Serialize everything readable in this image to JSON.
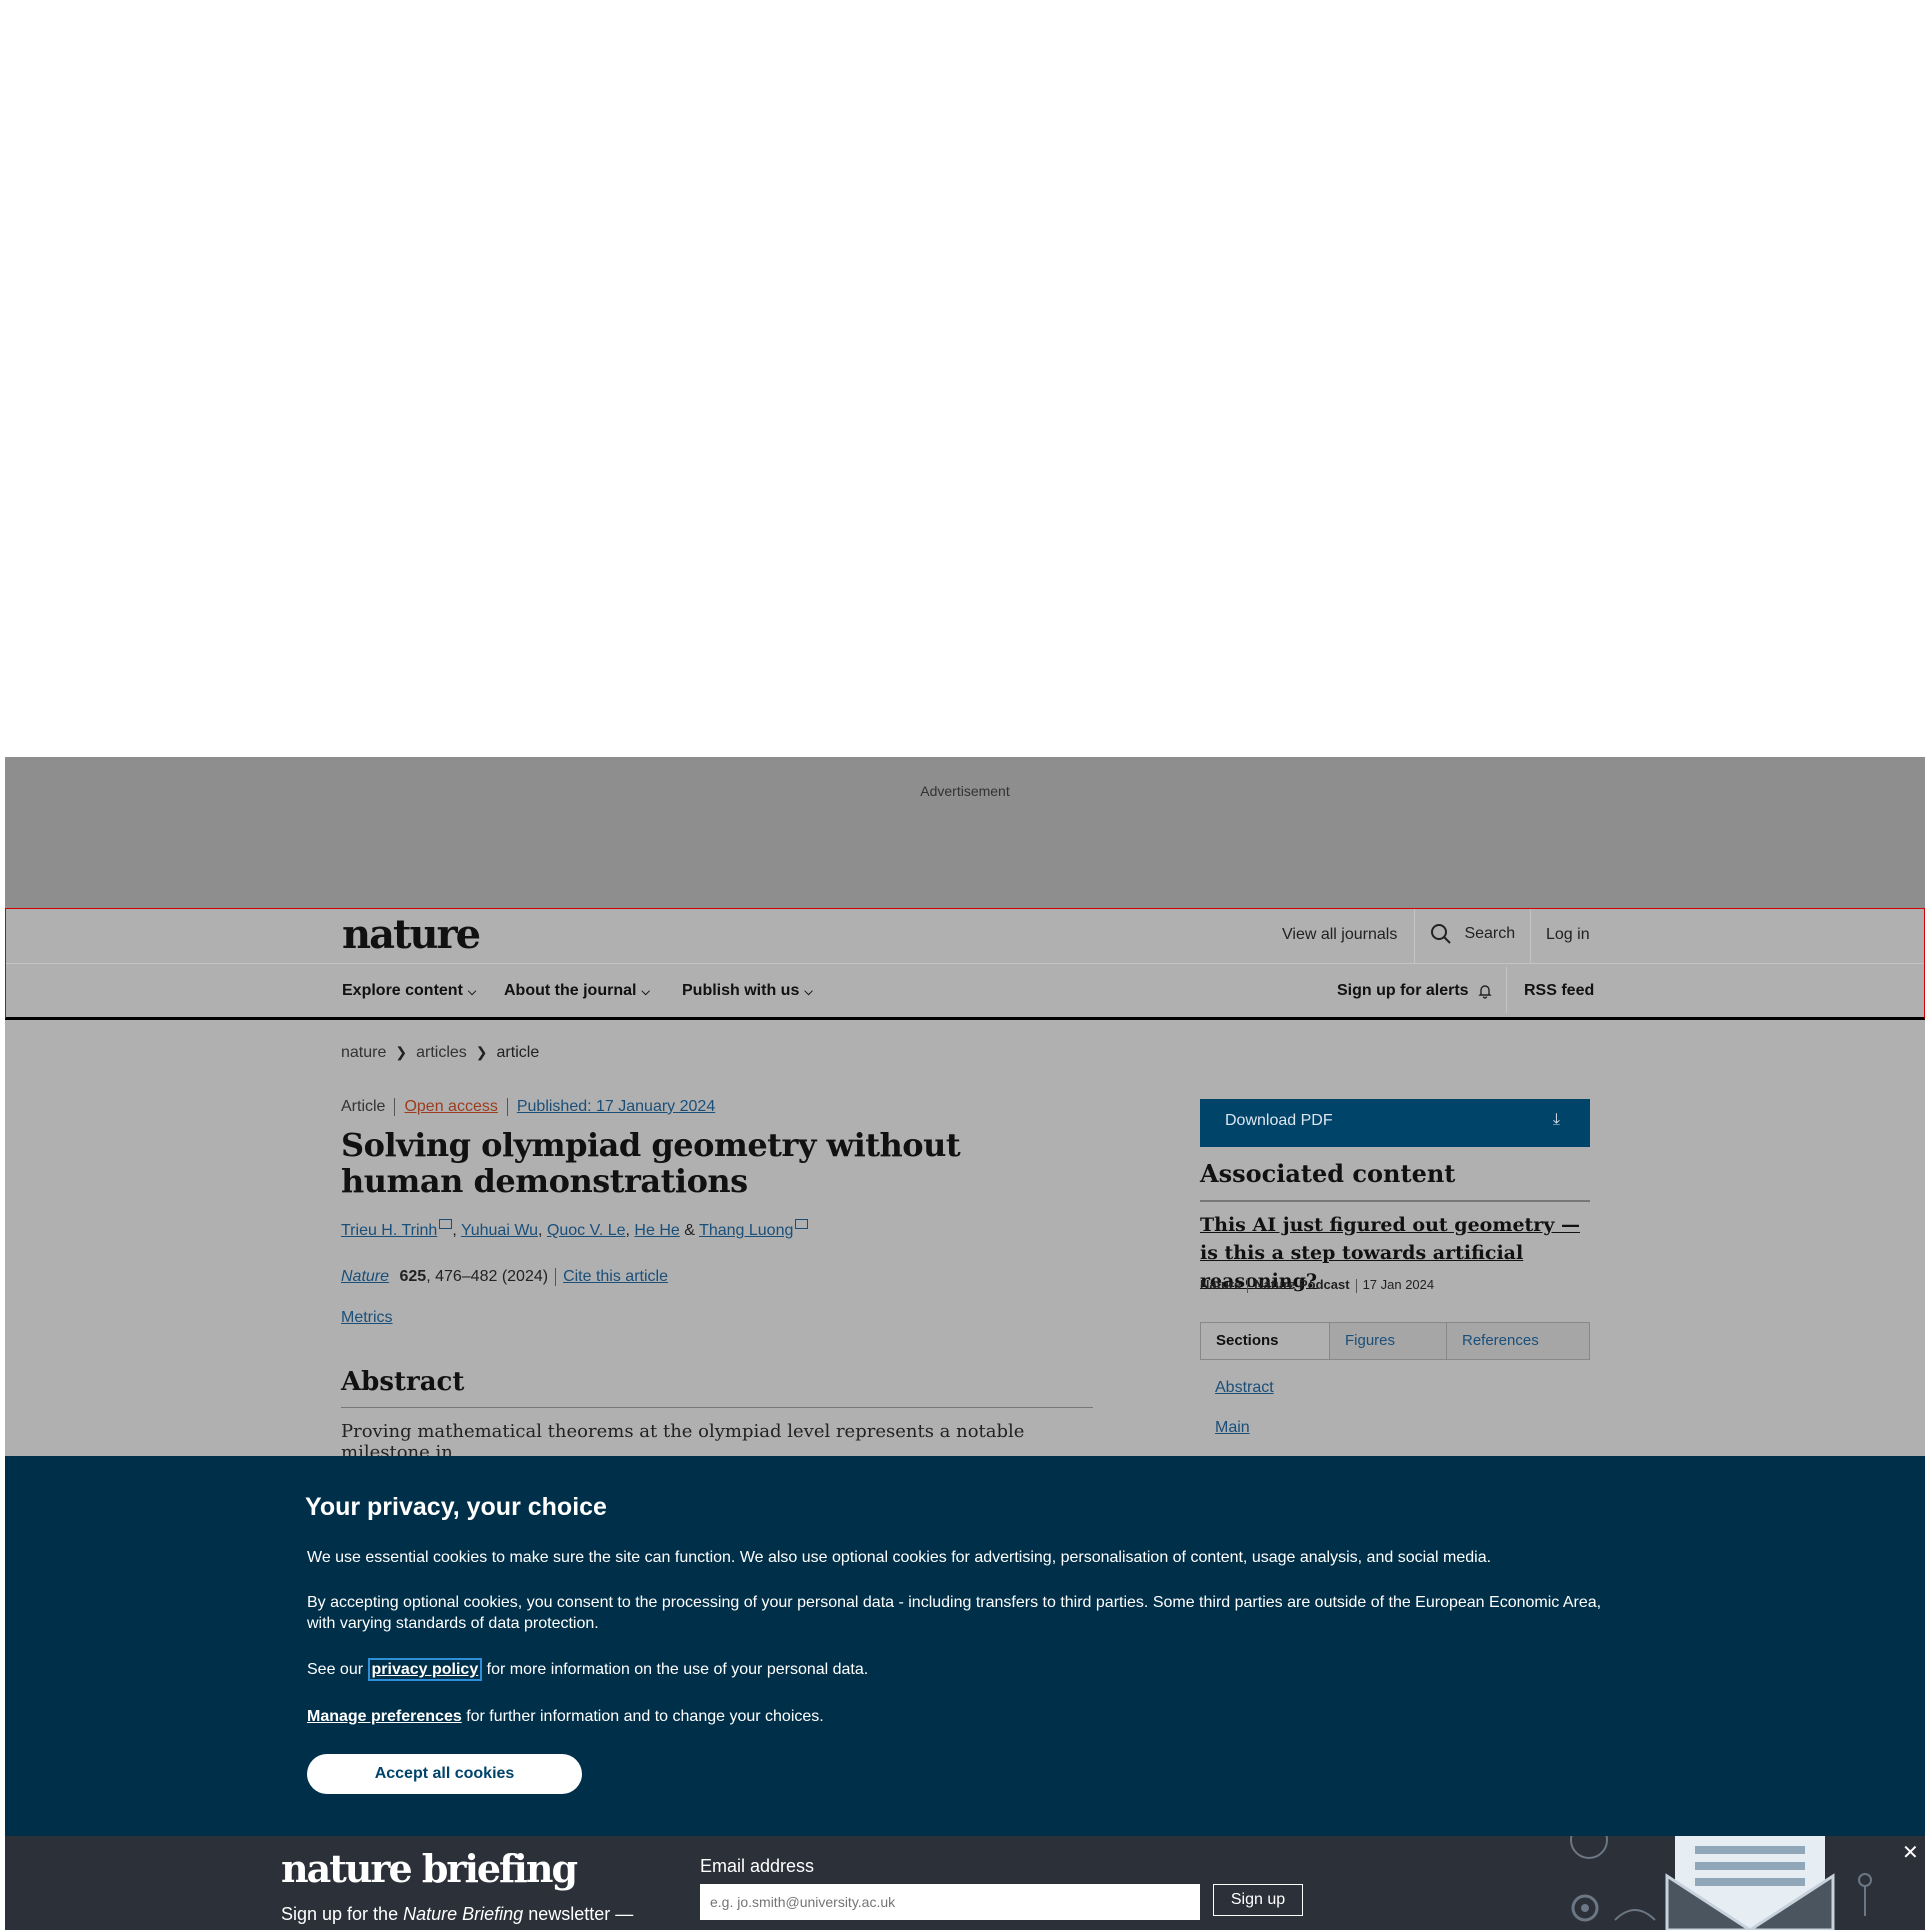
{
  "ad": {
    "label": "Advertisement"
  },
  "header": {
    "logo": "nature",
    "view_all": "View all journals",
    "search": "Search",
    "login": "Log in",
    "nav": {
      "explore": "Explore content",
      "about": "About the journal",
      "publish": "Publish with us"
    },
    "alerts": "Sign up for alerts",
    "rss": "RSS feed"
  },
  "breadcrumb": [
    "nature",
    "articles",
    "article"
  ],
  "article": {
    "type": "Article",
    "open_access": "Open access",
    "published": "Published: 17 January 2024",
    "title": "Solving olympiad geometry without human demonstrations",
    "authors": [
      "Trieu H. Trinh",
      "Yuhuai Wu",
      "Quoc V. Le",
      "He He",
      "Thang Luong"
    ],
    "author_sep": ",",
    "author_amp": "&",
    "journal": "Nature",
    "volume": "625",
    "pages": ", 476–482 (2024)",
    "cite": "Cite this article",
    "metrics": "Metrics",
    "abstract_heading": "Abstract",
    "abstract_text": "Proving mathematical theorems at the olympiad level represents a notable milestone in"
  },
  "sidebar": {
    "download": "Download PDF",
    "assoc_heading": "Associated content",
    "assoc_title": "This AI just figured out geometry — is this a step towards artificial reasoning?",
    "assoc_journal": "Nature",
    "assoc_type": "Nature Podcast",
    "assoc_date": "17 Jan 2024",
    "tabs": [
      "Sections",
      "Figures",
      "References"
    ],
    "sections": [
      "Abstract",
      "Main"
    ]
  },
  "cookie": {
    "heading": "Your privacy, your choice",
    "p1": "We use essential cookies to make sure the site can function. We also use optional cookies for advertising, personalisation of content, usage analysis, and social media.",
    "p2": "By accepting optional cookies, you consent to the processing of your personal data - including transfers to third parties. Some third parties are outside of the European Economic Area, with varying standards of data protection.",
    "p3_pre": "See our",
    "p3_link": "privacy policy",
    "p3_post": "for more information on the use of your personal data.",
    "p4_link": "Manage preferences",
    "p4_post": "for further information and to change your choices.",
    "accept": "Accept all cookies"
  },
  "briefing": {
    "logo": "nature briefing",
    "sub_pre": "Sign up for the",
    "sub_em": "Nature Briefing",
    "sub_post": "newsletter —",
    "email_label": "Email address",
    "email_placeholder": "e.g. jo.smith@university.ac.uk",
    "signup": "Sign up",
    "close": "✕"
  }
}
